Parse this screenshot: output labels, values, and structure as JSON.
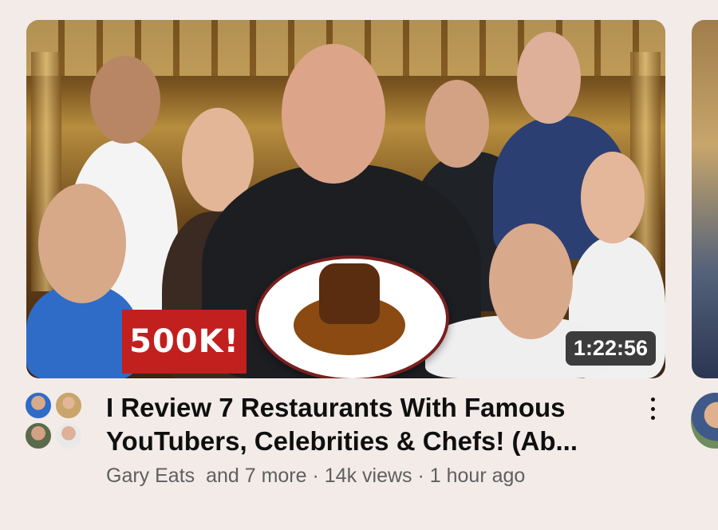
{
  "video": {
    "thumbnail_badge": "500K!",
    "duration": "1:22:56",
    "title": "I Review 7 Restaurants With Famous YouTubers, Celebrities & Chefs! (Ab...",
    "channel": "Gary Eats",
    "channel_suffix": "and 7 more",
    "views": "14k views",
    "posted": "1 hour ago",
    "separator": "·"
  },
  "colors": {
    "badge_red": "#c21f1f",
    "background": "#f2ebe8",
    "meta_gray": "#5f5f5f"
  },
  "icons": {
    "more_menu": "vertical-ellipsis-icon"
  }
}
